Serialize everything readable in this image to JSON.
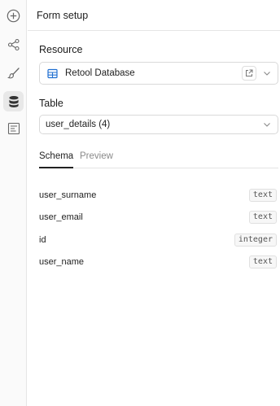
{
  "sidebar": {
    "buttons": [
      {
        "icon": "add-circle-icon"
      },
      {
        "icon": "share-nodes-icon"
      },
      {
        "icon": "paintbrush-icon"
      },
      {
        "icon": "database-icon",
        "active": true
      },
      {
        "icon": "form-icon"
      }
    ]
  },
  "panel": {
    "title": "Form setup",
    "resource": {
      "label": "Resource",
      "value": "Retool Database"
    },
    "table": {
      "label": "Table",
      "value": "user_details (4)"
    },
    "tabs": [
      {
        "label": "Schema",
        "active": true
      },
      {
        "label": "Preview",
        "active": false
      }
    ],
    "columns": [
      {
        "name": "user_surname",
        "type": "text"
      },
      {
        "name": "user_email",
        "type": "text"
      },
      {
        "name": "id",
        "type": "integer"
      },
      {
        "name": "user_name",
        "type": "text"
      }
    ]
  },
  "colors": {
    "accent": "#1f6fd1",
    "active_rail": "#e8e8e8"
  }
}
